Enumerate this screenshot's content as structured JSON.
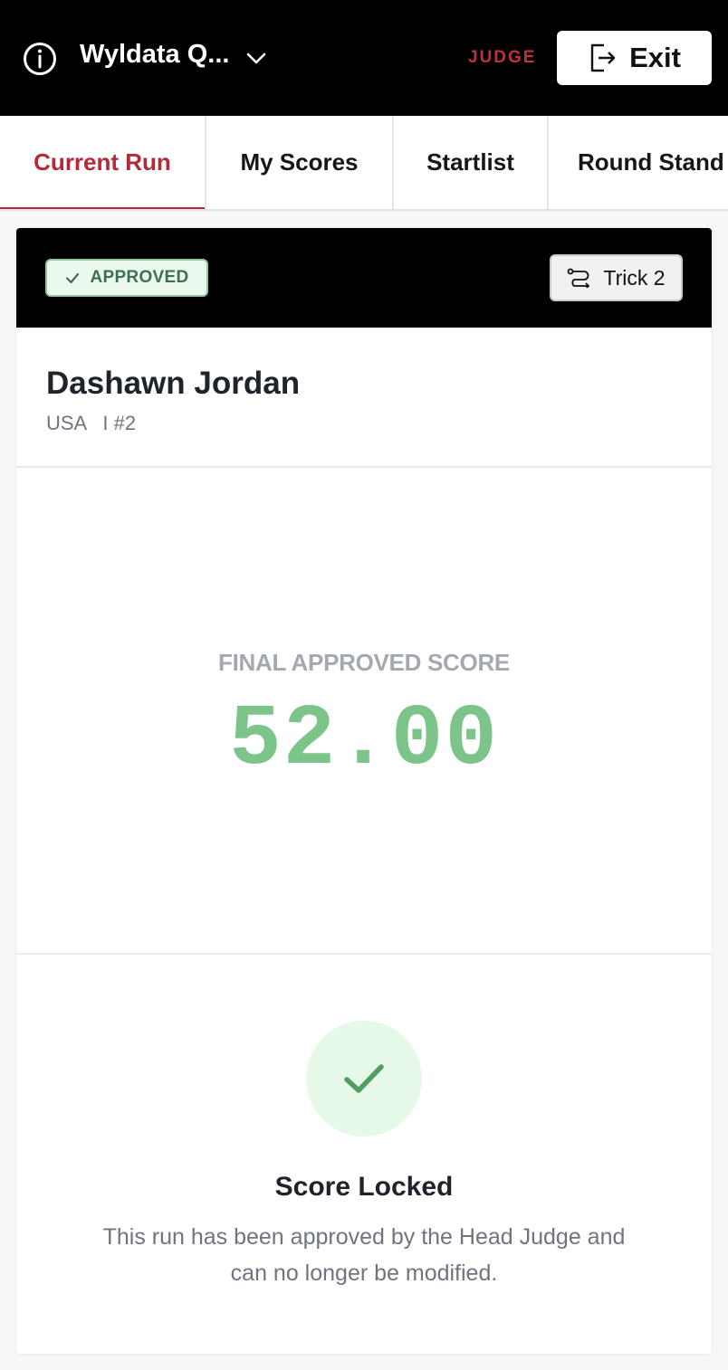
{
  "header": {
    "event_title": "Wyldata Q...",
    "role": "JUDGE",
    "exit_label": "Exit"
  },
  "tabs": [
    {
      "label": "Current Run",
      "active": true
    },
    {
      "label": "My Scores",
      "active": false
    },
    {
      "label": "Startlist",
      "active": false
    },
    {
      "label": "Round Stand",
      "active": false
    }
  ],
  "run": {
    "status": "APPROVED",
    "trick_label": "Trick 2",
    "athlete": {
      "name": "Dashawn Jordan",
      "meta": "USA   I #2"
    },
    "score_caption": "FINAL APPROVED SCORE",
    "score_value": "52.00",
    "locked_title": "Score Locked",
    "locked_description": "This run has been approved by the Head Judge and can no longer be modified."
  },
  "colors": {
    "accent_red": "#b52a39",
    "score_green": "#7cc48a",
    "header_black": "#000000"
  }
}
